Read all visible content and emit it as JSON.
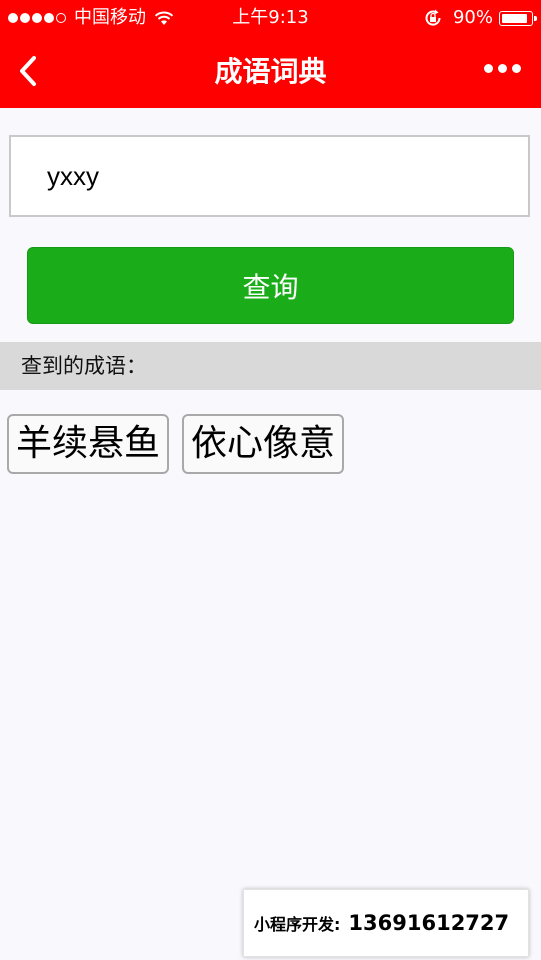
{
  "status_bar": {
    "carrier": "中国移动",
    "time": "上午9:13",
    "battery_percent": "90%",
    "battery_level": 0.9,
    "signal_bars": 4,
    "signal_total": 5
  },
  "nav": {
    "title": "成语词典",
    "back_icon": "chevron-left-icon",
    "more_icon": "more-dots-icon"
  },
  "search": {
    "value": "yxxy",
    "placeholder": ""
  },
  "query_button": {
    "label": "查询"
  },
  "results": {
    "label": "查到的成语：",
    "idioms": [
      "羊续悬鱼",
      "依心像意"
    ]
  },
  "contact": {
    "label": "小程序开发:",
    "phone": "13691612727"
  },
  "colors": {
    "header": "#ff0000",
    "button": "#1aad19",
    "results_bar": "#d9d9d9",
    "page_bg": "#f9f8fc"
  }
}
